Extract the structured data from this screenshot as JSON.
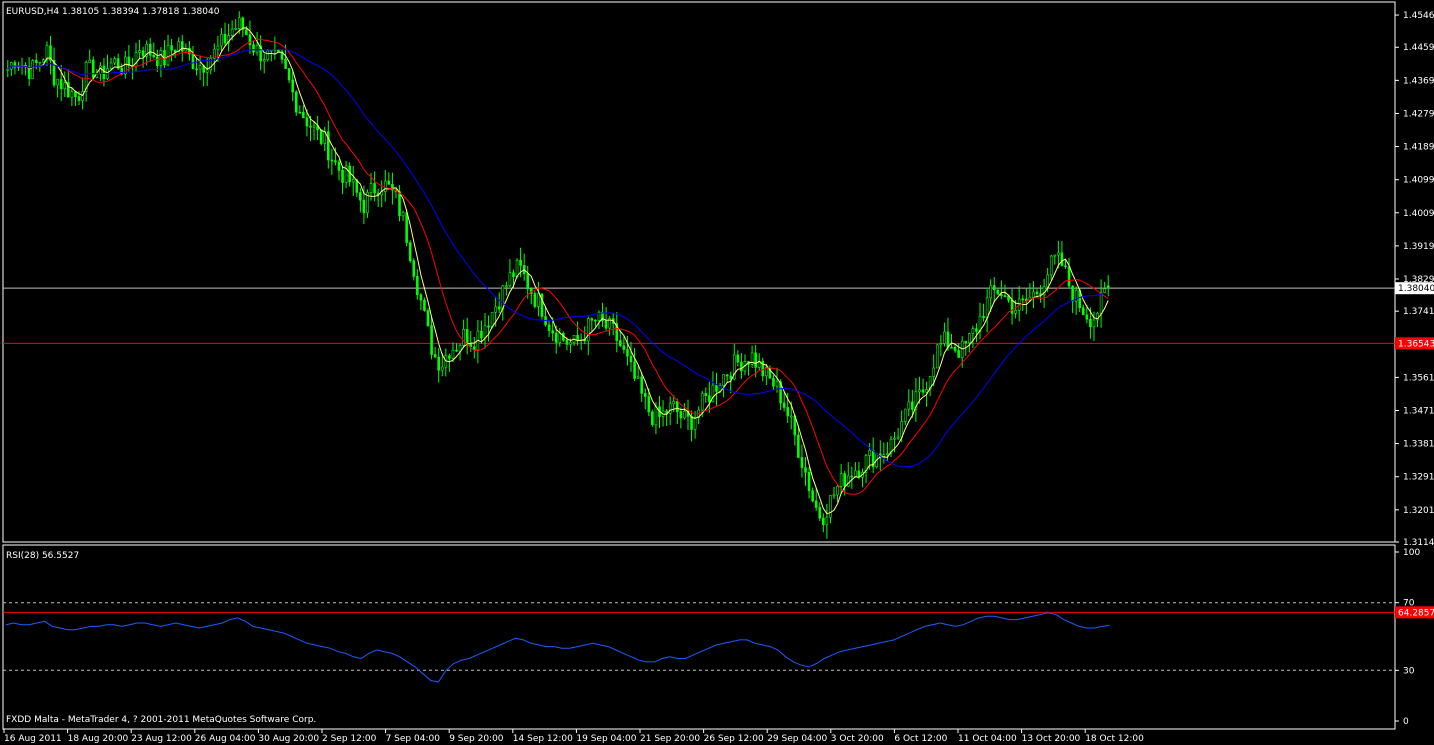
{
  "colors": {
    "background": "#000000",
    "frame": "#ffffff",
    "candle": "#00ff00",
    "ma_fast": "#ffff80",
    "ma_mid": "#ff0000",
    "ma_slow": "#0000ff",
    "rsi": "#1e5bff",
    "hline": "#ff0000",
    "bid_line": "#c0c0c0",
    "dotted": "#c0c0c0"
  },
  "main": {
    "header": "EURUSD,H4  1.38105 1.38394 1.37818 1.38040",
    "price_ticks": [
      "1.45465",
      "1.44590",
      "1.43690",
      "1.42790",
      "1.41890",
      "1.40990",
      "1.40090",
      "1.39190",
      "1.38290",
      "1.37415",
      "1.36515",
      "1.35615",
      "1.34715",
      "1.33815",
      "1.32915",
      "1.32015",
      "1.31140"
    ],
    "current_price": 1.3804,
    "current_price_label": "1.38040",
    "hline_price": 1.3654,
    "hline_label": "1.36543",
    "footer": "FXDD Malta - MetaTrader 4, ? 2001-2011 MetaQuotes Software Corp."
  },
  "rsi_panel": {
    "header": "RSI(28) 56.5527",
    "ticks": [
      "100",
      "70",
      "30",
      "0"
    ],
    "hline_value": 64.2857,
    "hline_label": "64.2857",
    "dotted_levels": [
      70,
      30
    ]
  },
  "time_axis": {
    "labels": [
      "16 Aug 2011",
      "18 Aug 20:00",
      "23 Aug 12:00",
      "26 Aug 04:00",
      "30 Aug 20:00",
      "2 Sep 12:00",
      "7 Sep 04:00",
      "9 Sep 20:00",
      "14 Sep 12:00",
      "19 Sep 04:00",
      "21 Sep 20:00",
      "26 Sep 12:00",
      "29 Sep 04:00",
      "3 Oct 20:00",
      "6 Oct 12:00",
      "11 Oct 04:00",
      "13 Oct 20:00",
      "18 Oct 12:00"
    ]
  },
  "chart_data": {
    "type": "candlestick",
    "symbol": "EURUSD",
    "timeframe": "H4",
    "last_bar": {
      "open": 1.38105,
      "high": 1.38394,
      "low": 1.37818,
      "close": 1.3804
    },
    "ylim": [
      1.3114,
      1.4582
    ],
    "series": [
      {
        "values": [
          1.44,
          1.443,
          1.441,
          1.4395,
          1.442,
          1.445,
          1.438,
          1.436,
          1.434,
          1.432,
          1.439,
          1.44,
          1.438,
          1.441,
          1.442,
          1.44,
          1.442,
          1.446,
          1.445,
          1.444,
          1.442,
          1.445,
          1.447,
          1.444,
          1.442,
          1.441,
          1.443,
          1.445,
          1.448,
          1.451,
          1.452,
          1.449,
          1.445,
          1.444,
          1.443,
          1.442,
          1.438,
          1.432,
          1.428,
          1.425,
          1.422,
          1.42,
          1.415,
          1.412,
          1.41,
          1.406,
          1.403,
          1.407,
          1.409,
          1.408,
          1.405,
          1.399,
          1.39,
          1.38,
          1.37,
          1.362,
          1.36,
          1.364,
          1.365,
          1.368,
          1.366,
          1.369,
          1.372,
          1.376,
          1.38,
          1.384,
          1.386,
          1.382,
          1.378,
          1.375,
          1.37,
          1.368,
          1.366,
          1.365,
          1.367,
          1.37,
          1.372,
          1.37,
          1.369,
          1.365,
          1.36,
          1.355,
          1.35,
          1.346,
          1.345,
          1.347,
          1.348,
          1.345,
          1.344,
          1.347,
          1.35,
          1.353,
          1.356,
          1.358,
          1.36,
          1.361,
          1.362,
          1.359,
          1.356,
          1.354,
          1.35,
          1.344,
          1.337,
          1.33,
          1.322,
          1.318,
          1.322,
          1.326,
          1.329,
          1.331,
          1.332,
          1.334,
          1.335,
          1.336,
          1.338,
          1.342,
          1.346,
          1.349,
          1.352,
          1.358,
          1.364,
          1.366,
          1.365,
          1.363,
          1.366,
          1.37,
          1.375,
          1.379,
          1.38,
          1.377,
          1.375,
          1.376,
          1.378,
          1.38,
          1.384,
          1.388,
          1.387,
          1.381,
          1.377,
          1.374,
          1.372,
          1.376,
          1.3804
        ]
      },
      {
        "period": 5,
        "kind": "moving average"
      },
      {
        "period": 14,
        "kind": "moving average"
      },
      {
        "period": 34,
        "kind": "moving average"
      },
      {
        "indicator": "RSI(28)",
        "values": [
          57,
          58,
          57,
          57,
          58,
          59,
          56,
          55,
          54,
          54,
          55,
          56,
          56,
          57,
          57,
          56,
          57,
          58,
          58,
          57,
          56,
          57,
          58,
          57,
          56,
          55,
          56,
          57,
          58,
          60,
          61,
          59,
          56,
          55,
          54,
          53,
          52,
          50,
          48,
          46,
          45,
          44,
          43,
          41,
          40,
          38,
          37,
          40,
          42,
          41,
          40,
          38,
          35,
          32,
          28,
          24,
          23,
          30,
          34,
          36,
          37,
          39,
          41,
          43,
          45,
          47,
          49,
          48,
          46,
          45,
          44,
          44,
          43,
          43,
          44,
          45,
          46,
          45,
          44,
          42,
          40,
          38,
          36,
          35,
          35,
          37,
          38,
          37,
          37,
          39,
          41,
          43,
          45,
          46,
          47,
          48,
          48,
          46,
          45,
          44,
          42,
          38,
          35,
          33,
          32,
          34,
          37,
          39,
          41,
          42,
          43,
          44,
          45,
          46,
          47,
          48,
          50,
          52,
          54,
          56,
          57,
          58,
          57,
          56,
          57,
          59,
          61,
          62,
          62,
          61,
          60,
          60,
          61,
          62,
          63,
          64,
          63,
          60,
          58,
          56,
          55,
          55,
          56,
          56.55
        ]
      }
    ]
  }
}
